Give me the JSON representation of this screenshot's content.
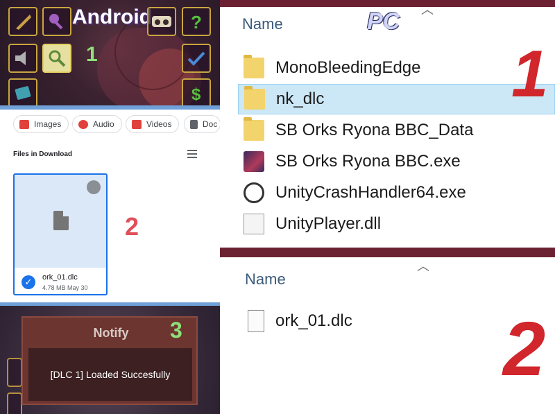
{
  "android": {
    "title": "Android",
    "step1": "1",
    "step2": "2",
    "step3": "3",
    "chips": [
      "Images",
      "Audio",
      "Videos",
      "Doc"
    ],
    "section_label": "Files in Download",
    "file": {
      "name": "ork_01.dlc",
      "meta": "4.78 MB May 30"
    },
    "notify": {
      "title": "Notify",
      "message": "[DLC 1] Loaded Succesfully"
    }
  },
  "pc": {
    "title": "PC",
    "column_header": "Name",
    "top_rows": [
      {
        "label": "MonoBleedingEdge",
        "icon": "folder-icon",
        "selected": false
      },
      {
        "label": "nk_dlc",
        "icon": "folder-icon",
        "selected": true
      },
      {
        "label": "SB Orks Ryona BBC_Data",
        "icon": "folder-icon",
        "selected": false
      },
      {
        "label": "SB Orks Ryona BBC.exe",
        "icon": "game-exe-icon",
        "selected": false
      },
      {
        "label": "UnityCrashHandler64.exe",
        "icon": "unity-icon",
        "selected": false
      },
      {
        "label": "UnityPlayer.dll",
        "icon": "dll-icon",
        "selected": false
      }
    ],
    "bottom_header": "Name",
    "bottom_rows": [
      {
        "label": "ork_01.dlc",
        "icon": "file-icon"
      }
    ],
    "step1": "1",
    "step2": "2"
  },
  "colors": {
    "accent_blue": "#1a73e8",
    "selection": "#cce8f7",
    "red_marker": "#d0262c",
    "green_marker": "#8fe07a",
    "border_maroon": "#6b2132"
  }
}
